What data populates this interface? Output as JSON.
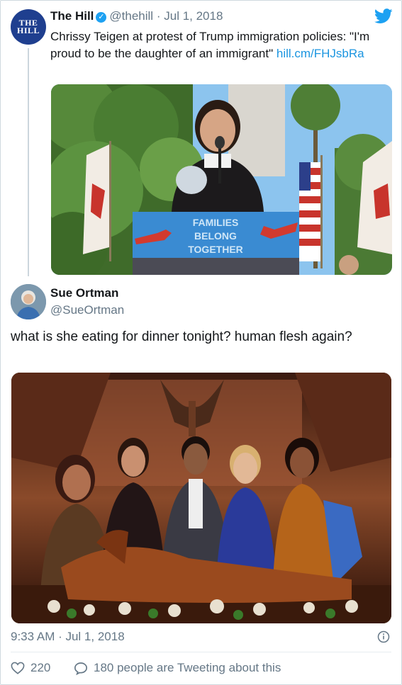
{
  "quoted_tweet": {
    "avatar_text": [
      "THE",
      "HILL"
    ],
    "display_name": "The Hill",
    "handle": "@thehill",
    "separator": "·",
    "date": "Jul 1, 2018",
    "text": "Chrissy Teigen at protest of Trump immigration policies: \"I'm proud to be the daughter of an immigrant\"",
    "link": "hill.cm/FHJsbRa",
    "photo": {
      "sign_lines": [
        "FAMILIES",
        "BELONG",
        "TOGETHER"
      ]
    }
  },
  "tweet": {
    "display_name": "Sue Ortman",
    "handle": "@SueOrtman",
    "text": "what is she eating for dinner tonight?  human flesh again?",
    "timestamp": "9:33 AM · Jul 1, 2018",
    "likes_count": "220",
    "replies_text": "180 people are Tweeting about this"
  },
  "icons": {
    "verified": "verified-badge-icon",
    "twitter": "twitter-bird-icon",
    "info": "info-icon",
    "like": "heart-icon",
    "reply": "speech-bubble-icon"
  },
  "colors": {
    "link": "#1b95e0",
    "verified": "#1da1f2",
    "muted": "#657786",
    "text": "#14171a"
  }
}
